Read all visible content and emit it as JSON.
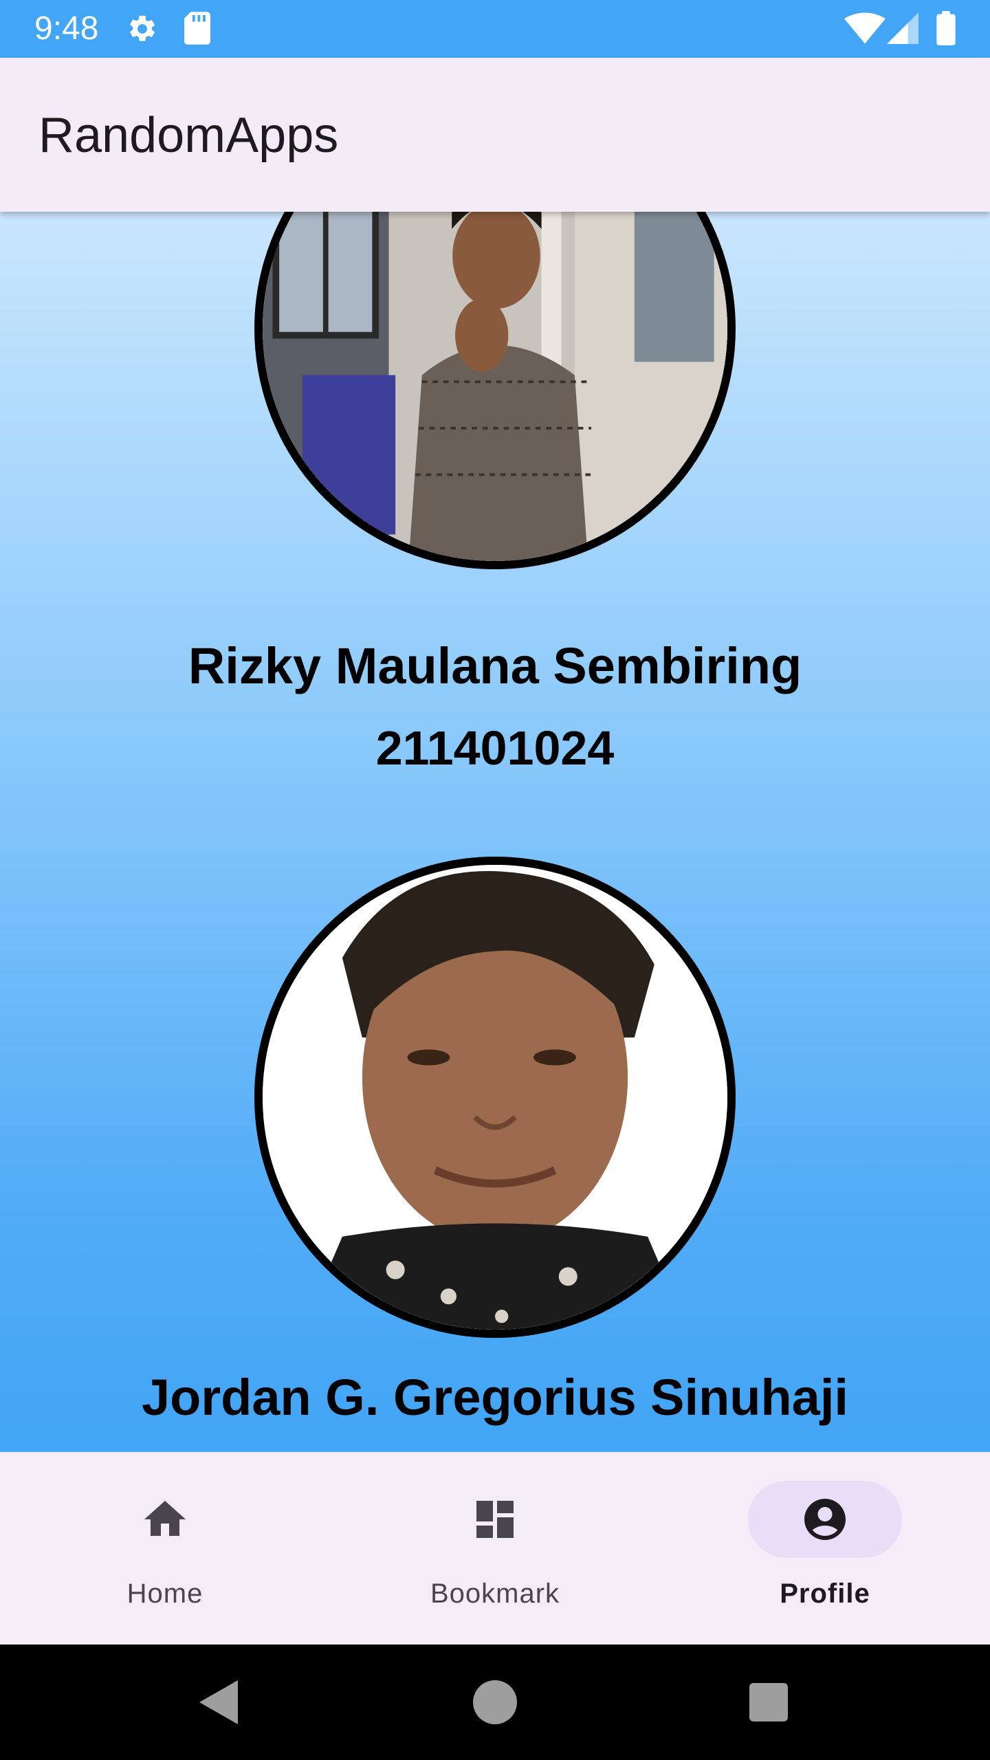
{
  "status_bar": {
    "time": "9:48",
    "icons": [
      "gear-icon",
      "sd-card-icon",
      "wifi-icon",
      "signal-icon",
      "battery-icon"
    ],
    "color": "#42a5f5"
  },
  "app_bar": {
    "title": "RandomApps",
    "background": "#f3ecf6"
  },
  "profiles": [
    {
      "name": "Rizky Maulana Sembiring",
      "nim": "211401024"
    },
    {
      "name": "Jordan G. Gregorius Sinuhaji",
      "nim": ""
    }
  ],
  "bottom_nav": {
    "items": [
      {
        "label": "Home",
        "icon": "home-icon",
        "active": false
      },
      {
        "label": "Bookmark",
        "icon": "dashboard-icon",
        "active": false
      },
      {
        "label": "Profile",
        "icon": "account-circle-icon",
        "active": true
      }
    ],
    "indicator_color": "#e8def8"
  },
  "system_nav": {
    "buttons": [
      "back-icon",
      "home-circle-icon",
      "recents-icon"
    ]
  }
}
